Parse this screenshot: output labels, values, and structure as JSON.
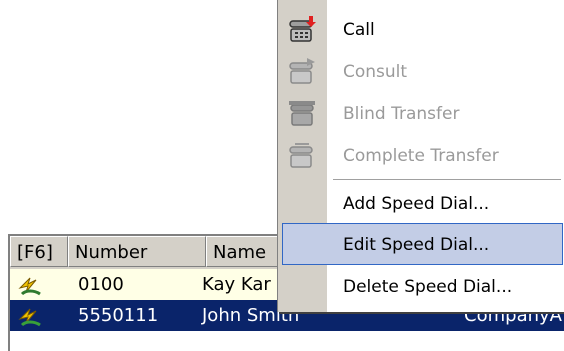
{
  "menu": {
    "items": [
      {
        "label": "Call",
        "icon": "phone-dial-icon",
        "enabled": true
      },
      {
        "label": "Consult",
        "icon": "phone-consult-icon",
        "enabled": false
      },
      {
        "label": "Blind Transfer",
        "icon": "phone-blind-transfer-icon",
        "enabled": false
      },
      {
        "label": "Complete Transfer",
        "icon": "phone-complete-transfer-icon",
        "enabled": false
      },
      {
        "label": "Add Speed Dial...",
        "enabled": true
      },
      {
        "label": "Edit Speed Dial...",
        "enabled": true,
        "selected": true
      },
      {
        "label": "Delete Speed Dial...",
        "enabled": true
      }
    ]
  },
  "list": {
    "columns": [
      "[F6]",
      "Number",
      "Name"
    ],
    "rows": [
      {
        "number": "0100",
        "name": "Kay Kar",
        "company": ""
      },
      {
        "number": "5550111",
        "name": "John Smith",
        "company": "CompanyA",
        "selected": true
      }
    ]
  },
  "colors": {
    "selection_bg": "#0a246a",
    "menu_highlight": "#c3cde6",
    "header_bg": "#d4d0c8"
  }
}
